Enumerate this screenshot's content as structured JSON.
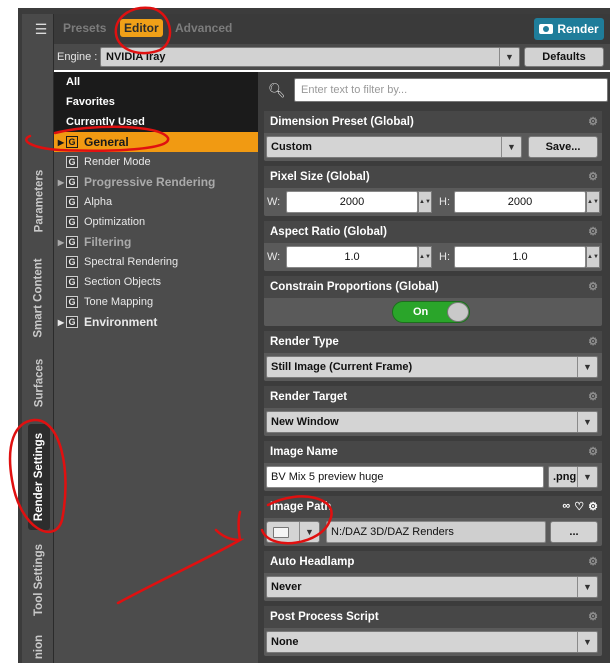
{
  "tabs": {
    "presets": "Presets",
    "editor": "Editor",
    "advanced": "Advanced"
  },
  "render_button": "Render",
  "engine": {
    "label": "Engine :",
    "value": "NVIDIA Iray",
    "defaults": "Defaults"
  },
  "side_tabs": [
    "Parameters",
    "Smart Content",
    "Surfaces",
    "Render Settings",
    "Tool Settings",
    "nion"
  ],
  "tree": {
    "all": "All",
    "favorites": "Favorites",
    "currently_used": "Currently Used",
    "general": "General",
    "render_mode": "Render Mode",
    "progressive": "Progressive Rendering",
    "alpha": "Alpha",
    "optimization": "Optimization",
    "filtering": "Filtering",
    "spectral": "Spectral Rendering",
    "section_objects": "Section Objects",
    "tone_mapping": "Tone Mapping",
    "environment": "Environment",
    "g": "G"
  },
  "search": {
    "placeholder": "Enter text to filter by..."
  },
  "props": {
    "dimension_preset": {
      "title": "Dimension Preset (Global)",
      "value": "Custom",
      "button": "Save..."
    },
    "pixel_size": {
      "title": "Pixel Size (Global)",
      "w_label": "W:",
      "w": "2000",
      "h_label": "H:",
      "h": "2000"
    },
    "aspect_ratio": {
      "title": "Aspect Ratio (Global)",
      "w_label": "W:",
      "w": "1.0",
      "h_label": "H:",
      "h": "1.0"
    },
    "constrain": {
      "title": "Constrain Proportions (Global)",
      "value": "On"
    },
    "render_type": {
      "title": "Render Type",
      "value": "Still Image (Current Frame)"
    },
    "render_target": {
      "title": "Render Target",
      "value": "New Window"
    },
    "image_name": {
      "title": "Image Name",
      "value": "BV Mix 5 preview huge",
      "ext": ".png"
    },
    "image_path": {
      "title": "Image Path",
      "value": "N:/DAZ 3D/DAZ Renders",
      "browse": "..."
    },
    "auto_headlamp": {
      "title": "Auto Headlamp",
      "value": "Never"
    },
    "post_process": {
      "title": "Post Process Script",
      "value": "None"
    }
  },
  "colors": {
    "accent": "#f19a12",
    "render": "#1f7d9a",
    "toggle_on": "#2aa52a",
    "annotation": "#e01010"
  }
}
